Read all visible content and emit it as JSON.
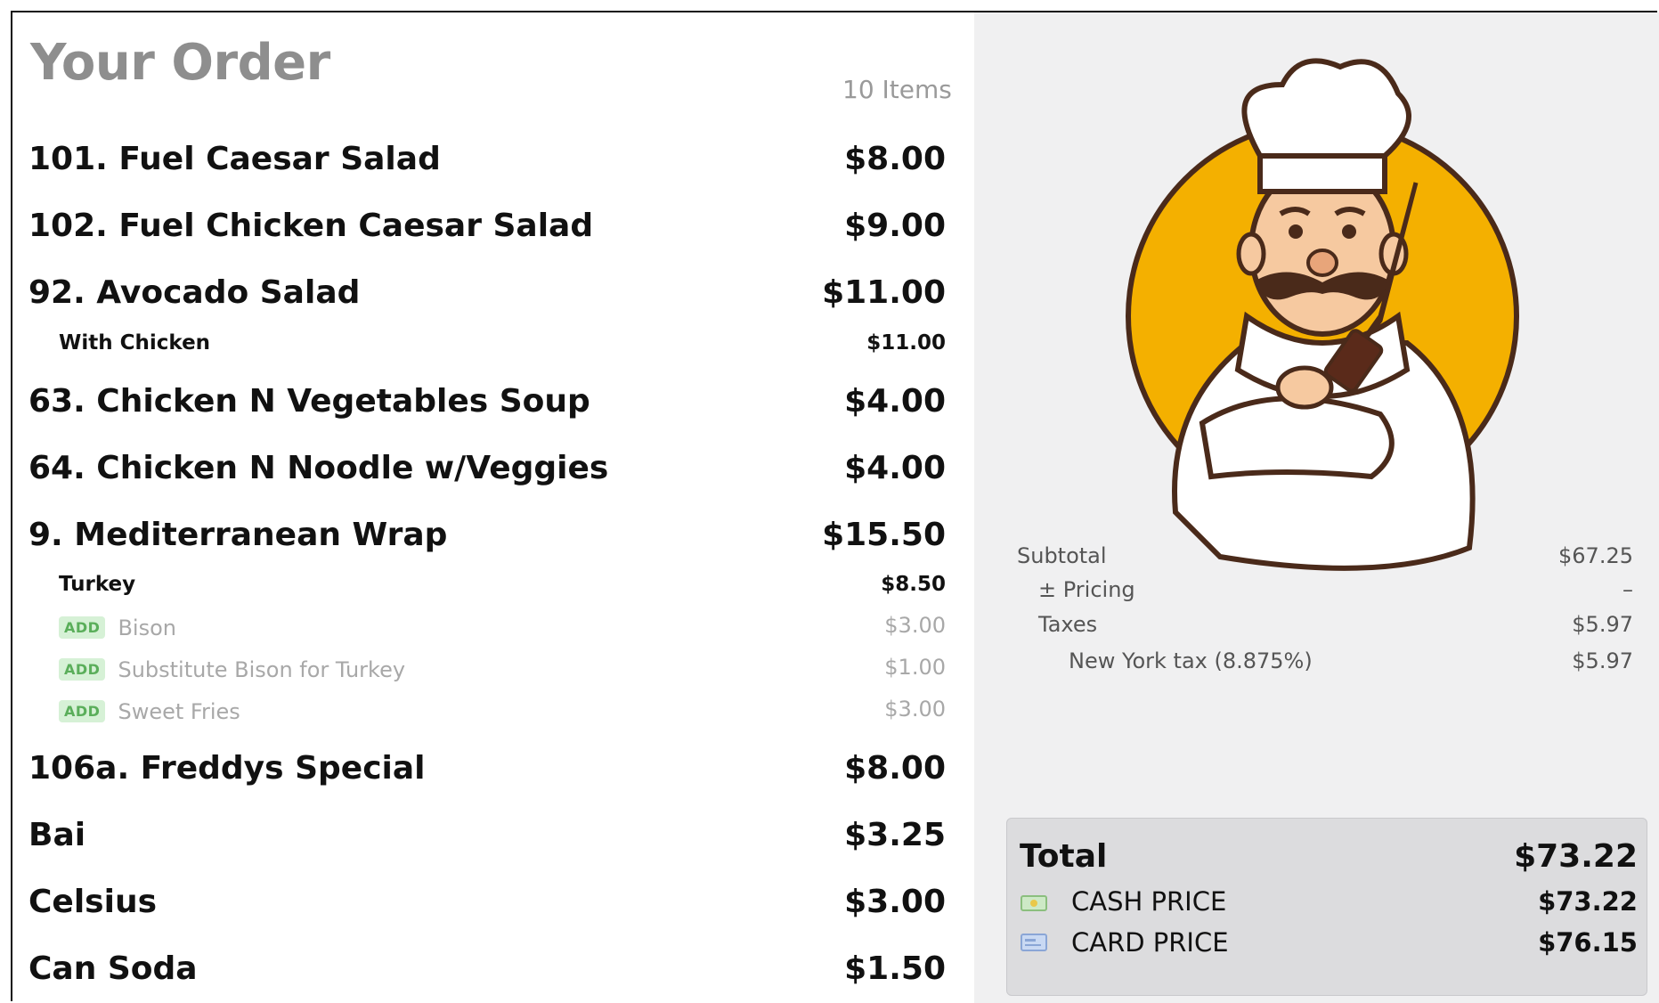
{
  "order": {
    "title": "Your Order",
    "item_count": "10 Items",
    "lines": [
      {
        "name": "101. Fuel Caesar Salad",
        "price": "$8.00"
      },
      {
        "name": "102. Fuel Chicken Caesar Salad",
        "price": "$9.00"
      },
      {
        "name": "92. Avocado Salad",
        "price": "$11.00"
      },
      {
        "name": "With Chicken",
        "price": "$11.00"
      },
      {
        "name": "63. Chicken N Vegetables Soup",
        "price": "$4.00"
      },
      {
        "name": "64. Chicken N Noodle w/Veggies",
        "price": "$4.00"
      },
      {
        "name": "9. Mediterranean Wrap",
        "price": "$15.50"
      },
      {
        "name": "Turkey",
        "price": "$8.50"
      },
      {
        "badge": "ADD",
        "name": "Bison",
        "price": "$3.00"
      },
      {
        "badge": "ADD",
        "name": "Substitute Bison for Turkey",
        "price": "$1.00"
      },
      {
        "badge": "ADD",
        "name": "Sweet Fries",
        "price": "$3.00"
      },
      {
        "name": "106a. Freddys Special",
        "price": "$8.00"
      },
      {
        "name": "Bai",
        "price": "$3.25"
      },
      {
        "name": "Celsius",
        "price": "$3.00"
      },
      {
        "name": "Can Soda",
        "price": "$1.50"
      }
    ]
  },
  "summary": {
    "subtotal_label": "Subtotal",
    "subtotal": "$67.25",
    "pricing_label": "± Pricing",
    "pricing": "–",
    "taxes_label": "Taxes",
    "taxes": "$5.97",
    "ny_tax_label": "New York tax  (8.875%)",
    "ny_tax": "$5.97"
  },
  "totals": {
    "total_label": "Total",
    "total": "$73.22",
    "cash_label": "CASH PRICE",
    "cash": "$73.22",
    "card_label": "CARD PRICE",
    "card": "$76.15"
  },
  "colors": {
    "accent_circle": "#f4b000",
    "add_badge_bg": "#d6f1d6",
    "add_badge_text": "#5aae5a"
  },
  "icons": {
    "mascot": "chef-mascot",
    "cash": "cash-icon",
    "card": "card-icon"
  }
}
